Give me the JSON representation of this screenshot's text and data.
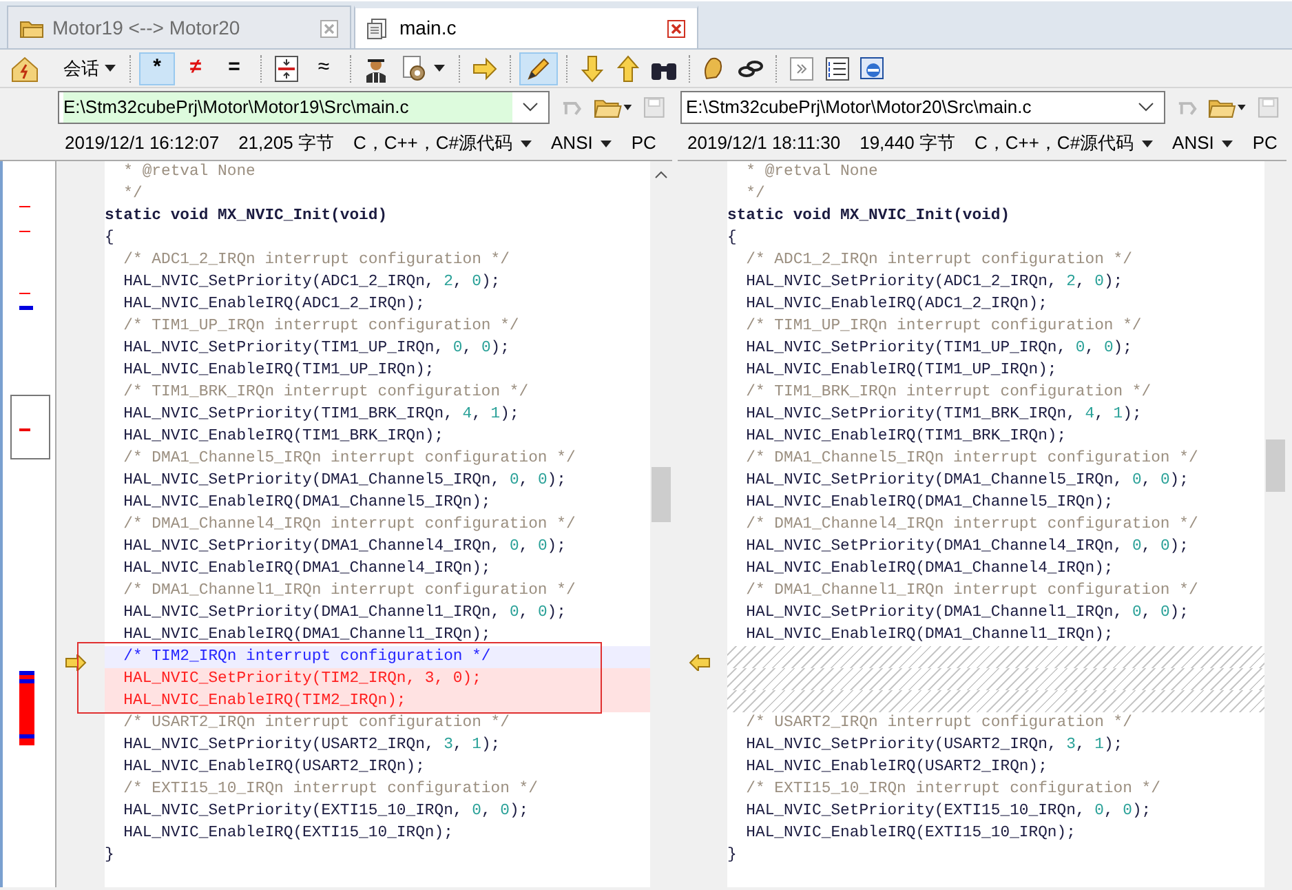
{
  "tabs": [
    {
      "label": "Motor19 <--> Motor20",
      "selected": false
    },
    {
      "label": "main.c",
      "selected": true
    }
  ],
  "toolbar": {
    "session_label": "会话",
    "filters": [
      {
        "label": "*",
        "selected": true
      },
      {
        "label": "≠",
        "selected": false
      },
      {
        "label": "=",
        "selected": false
      }
    ],
    "similar_label": "≈",
    "edit_selected": true
  },
  "panes": [
    {
      "path": "E:\\Stm32cubePrj\\Motor\\Motor19\\Src\\main.c",
      "focused": true,
      "date": "2019/12/1 16:12:07",
      "size": "21,205 字节",
      "format": "C，C++，C#源代码",
      "encoding": "ANSI",
      "line_end": "PC",
      "rows": [
        {
          "text": "  * @retval None",
          "kind": "comment"
        },
        {
          "text": "  */",
          "kind": "comment"
        },
        {
          "text": "static void MX_NVIC_Init(void)",
          "kind": "heading"
        },
        {
          "text": "{",
          "kind": "code"
        },
        {
          "text": "  /* ADC1_2_IRQn interrupt configuration */",
          "kind": "comment"
        },
        {
          "text": "  HAL_NVIC_SetPriority(ADC1_2_IRQn, 2, 0);",
          "kind": "code"
        },
        {
          "text": "  HAL_NVIC_EnableIRQ(ADC1_2_IRQn);",
          "kind": "code"
        },
        {
          "text": "  /* TIM1_UP_IRQn interrupt configuration */",
          "kind": "comment"
        },
        {
          "text": "  HAL_NVIC_SetPriority(TIM1_UP_IRQn, 0, 0);",
          "kind": "code"
        },
        {
          "text": "  HAL_NVIC_EnableIRQ(TIM1_UP_IRQn);",
          "kind": "code"
        },
        {
          "text": "  /* TIM1_BRK_IRQn interrupt configuration */",
          "kind": "comment"
        },
        {
          "text": "  HAL_NVIC_SetPriority(TIM1_BRK_IRQn, 4, 1);",
          "kind": "code"
        },
        {
          "text": "  HAL_NVIC_EnableIRQ(TIM1_BRK_IRQn);",
          "kind": "code"
        },
        {
          "text": "  /* DMA1_Channel5_IRQn interrupt configuration */",
          "kind": "comment"
        },
        {
          "text": "  HAL_NVIC_SetPriority(DMA1_Channel5_IRQn, 0, 0);",
          "kind": "code"
        },
        {
          "text": "  HAL_NVIC_EnableIRQ(DMA1_Channel5_IRQn);",
          "kind": "code"
        },
        {
          "text": "  /* DMA1_Channel4_IRQn interrupt configuration */",
          "kind": "comment"
        },
        {
          "text": "  HAL_NVIC_SetPriority(DMA1_Channel4_IRQn, 0, 0);",
          "kind": "code"
        },
        {
          "text": "  HAL_NVIC_EnableIRQ(DMA1_Channel4_IRQn);",
          "kind": "code"
        },
        {
          "text": "  /* DMA1_Channel1_IRQn interrupt configuration */",
          "kind": "comment"
        },
        {
          "text": "  HAL_NVIC_SetPriority(DMA1_Channel1_IRQn, 0, 0);",
          "kind": "code"
        },
        {
          "text": "  HAL_NVIC_EnableIRQ(DMA1_Channel1_IRQn);",
          "kind": "code"
        },
        {
          "text": "  /* TIM2_IRQn interrupt configuration */",
          "kind": "changed"
        },
        {
          "text": "  HAL_NVIC_SetPriority(TIM2_IRQn, 3, 0);",
          "kind": "removed"
        },
        {
          "text": "  HAL_NVIC_EnableIRQ(TIM2_IRQn);",
          "kind": "removed"
        },
        {
          "text": "  /* USART2_IRQn interrupt configuration */",
          "kind": "comment"
        },
        {
          "text": "  HAL_NVIC_SetPriority(USART2_IRQn, 3, 1);",
          "kind": "code"
        },
        {
          "text": "  HAL_NVIC_EnableIRQ(USART2_IRQn);",
          "kind": "code"
        },
        {
          "text": "  /* EXTI15_10_IRQn interrupt configuration */",
          "kind": "comment"
        },
        {
          "text": "  HAL_NVIC_SetPriority(EXTI15_10_IRQn, 0, 0);",
          "kind": "code"
        },
        {
          "text": "  HAL_NVIC_EnableIRQ(EXTI15_10_IRQn);",
          "kind": "code"
        },
        {
          "text": "}",
          "kind": "code"
        }
      ]
    },
    {
      "path": "E:\\Stm32cubePrj\\Motor\\Motor20\\Src\\main.c",
      "focused": false,
      "date": "2019/12/1 18:11:30",
      "size": "19,440 字节",
      "format": "C，C++，C#源代码",
      "encoding": "ANSI",
      "line_end": "PC",
      "rows": [
        {
          "text": "  * @retval None",
          "kind": "comment"
        },
        {
          "text": "  */",
          "kind": "comment"
        },
        {
          "text": "static void MX_NVIC_Init(void)",
          "kind": "heading"
        },
        {
          "text": "{",
          "kind": "code"
        },
        {
          "text": "  /* ADC1_2_IRQn interrupt configuration */",
          "kind": "comment"
        },
        {
          "text": "  HAL_NVIC_SetPriority(ADC1_2_IRQn, 2, 0);",
          "kind": "code"
        },
        {
          "text": "  HAL_NVIC_EnableIRQ(ADC1_2_IRQn);",
          "kind": "code"
        },
        {
          "text": "  /* TIM1_UP_IRQn interrupt configuration */",
          "kind": "comment"
        },
        {
          "text": "  HAL_NVIC_SetPriority(TIM1_UP_IRQn, 0, 0);",
          "kind": "code"
        },
        {
          "text": "  HAL_NVIC_EnableIRQ(TIM1_UP_IRQn);",
          "kind": "code"
        },
        {
          "text": "  /* TIM1_BRK_IRQn interrupt configuration */",
          "kind": "comment"
        },
        {
          "text": "  HAL_NVIC_SetPriority(TIM1_BRK_IRQn, 4, 1);",
          "kind": "code"
        },
        {
          "text": "  HAL_NVIC_EnableIRQ(TIM1_BRK_IRQn);",
          "kind": "code"
        },
        {
          "text": "  /* DMA1_Channel5_IRQn interrupt configuration */",
          "kind": "comment"
        },
        {
          "text": "  HAL_NVIC_SetPriority(DMA1_Channel5_IRQn, 0, 0);",
          "kind": "code"
        },
        {
          "text": "  HAL_NVIC_EnableIRQ(DMA1_Channel5_IRQn);",
          "kind": "code"
        },
        {
          "text": "  /* DMA1_Channel4_IRQn interrupt configuration */",
          "kind": "comment"
        },
        {
          "text": "  HAL_NVIC_SetPriority(DMA1_Channel4_IRQn, 0, 0);",
          "kind": "code"
        },
        {
          "text": "  HAL_NVIC_EnableIRQ(DMA1_Channel4_IRQn);",
          "kind": "code"
        },
        {
          "text": "  /* DMA1_Channel1_IRQn interrupt configuration */",
          "kind": "comment"
        },
        {
          "text": "  HAL_NVIC_SetPriority(DMA1_Channel1_IRQn, 0, 0);",
          "kind": "code"
        },
        {
          "text": "  HAL_NVIC_EnableIRQ(DMA1_Channel1_IRQn);",
          "kind": "code"
        },
        {
          "kind": "gap"
        },
        {
          "kind": "gap"
        },
        {
          "kind": "gap"
        },
        {
          "text": "  /* USART2_IRQn interrupt configuration */",
          "kind": "comment"
        },
        {
          "text": "  HAL_NVIC_SetPriority(USART2_IRQn, 3, 1);",
          "kind": "code"
        },
        {
          "text": "  HAL_NVIC_EnableIRQ(USART2_IRQn);",
          "kind": "code"
        },
        {
          "text": "  /* EXTI15_10_IRQn interrupt configuration */",
          "kind": "comment"
        },
        {
          "text": "  HAL_NVIC_SetPriority(EXTI15_10_IRQn, 0, 0);",
          "kind": "code"
        },
        {
          "text": "  HAL_NVIC_EnableIRQ(EXTI15_10_IRQn);",
          "kind": "code"
        },
        {
          "text": "}",
          "kind": "code"
        }
      ]
    }
  ]
}
